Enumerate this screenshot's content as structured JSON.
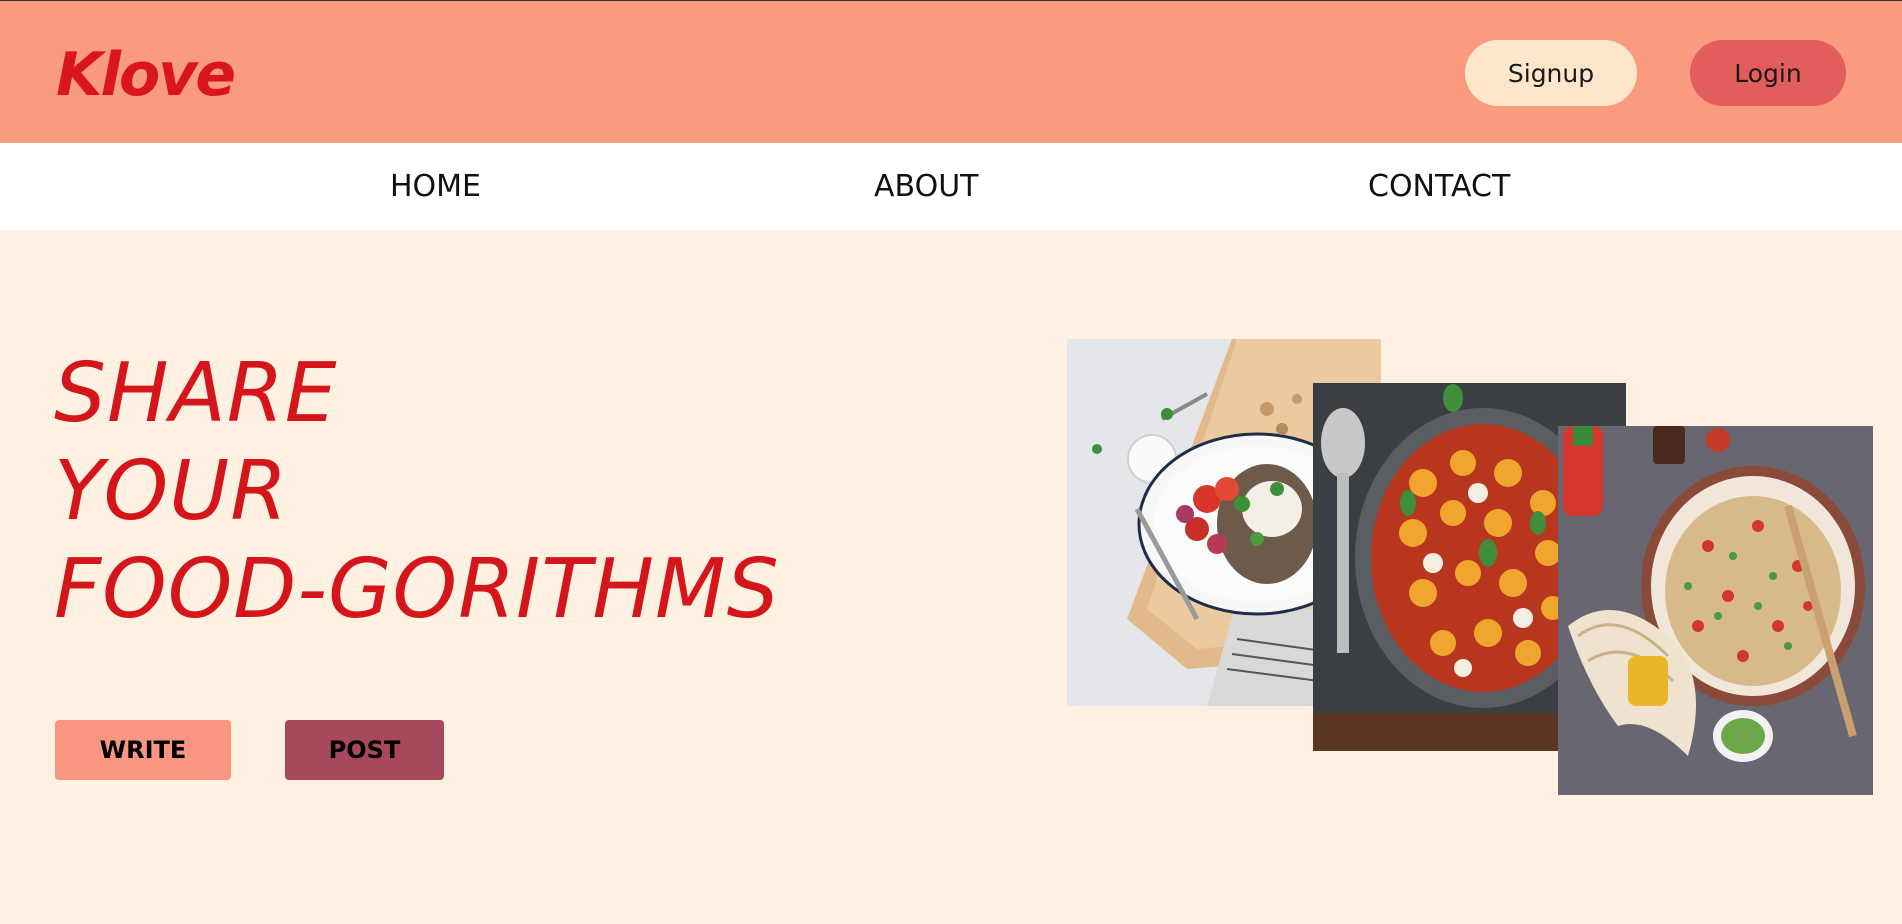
{
  "header": {
    "brand": "Klove",
    "signup_label": "Signup",
    "login_label": "Login"
  },
  "nav": {
    "items": [
      {
        "label": "HOME"
      },
      {
        "label": "ABOUT"
      },
      {
        "label": "CONTACT"
      }
    ]
  },
  "hero": {
    "headline_lines": [
      "SHARE",
      "YOUR",
      "FOOD-GORITHMS"
    ],
    "write_label": "WRITE",
    "post_label": "POST"
  },
  "colors": {
    "header_bg": "#fa9a7f",
    "brand": "#d8161b",
    "hero_bg": "#fff1e1",
    "signup_bg": "#fde6cc",
    "login_bg": "#e35d5d",
    "write_bg": "#f99682",
    "post_bg": "#a8485c"
  },
  "images": [
    {
      "name": "eggplant-salad-dish"
    },
    {
      "name": "gnocchi-baked-dish"
    },
    {
      "name": "rice-bowl-dish"
    }
  ]
}
